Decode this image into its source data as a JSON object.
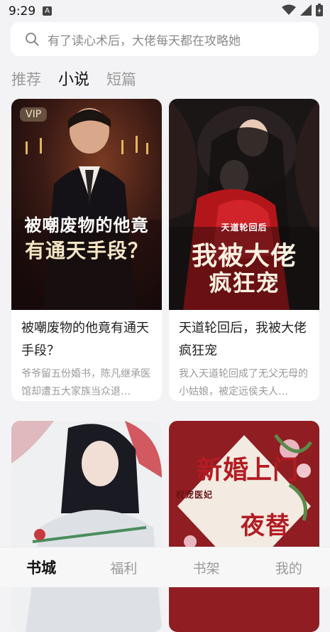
{
  "status": {
    "time": "9:29",
    "badge": "A"
  },
  "search": {
    "placeholder": "有了读心术后，大佬每天都在攻略她"
  },
  "tabs": [
    {
      "label": "推荐"
    },
    {
      "label": "小说"
    },
    {
      "label": "短篇"
    }
  ],
  "books": [
    {
      "title": "被嘲废物的他竟有通天手段？",
      "desc": "爷爷留五份婚书，陈凡继承医馆却遭五大家族当众退…",
      "vip": "VIP",
      "cover_line1": "被嘲废物的他竟",
      "cover_line2": "有通天手段？"
    },
    {
      "title": "天道轮回后，我被大佬疯狂宠",
      "desc": "我入天道轮回成了无父无母的小姑娘，被定远侯夫人…",
      "cover_sub": "天道轮回后",
      "cover_line1": "我被大佬",
      "cover_line2": "疯狂宠"
    },
    {
      "title": "",
      "desc": ""
    },
    {
      "title": "",
      "desc": "",
      "cover_line1": "新婚",
      "cover_line2": "上门",
      "cover_line3": "夜替",
      "cover_side": "权宠医妃"
    }
  ],
  "bottom_nav": [
    {
      "label": "书城"
    },
    {
      "label": "福利"
    },
    {
      "label": "书架"
    },
    {
      "label": "我的"
    }
  ]
}
